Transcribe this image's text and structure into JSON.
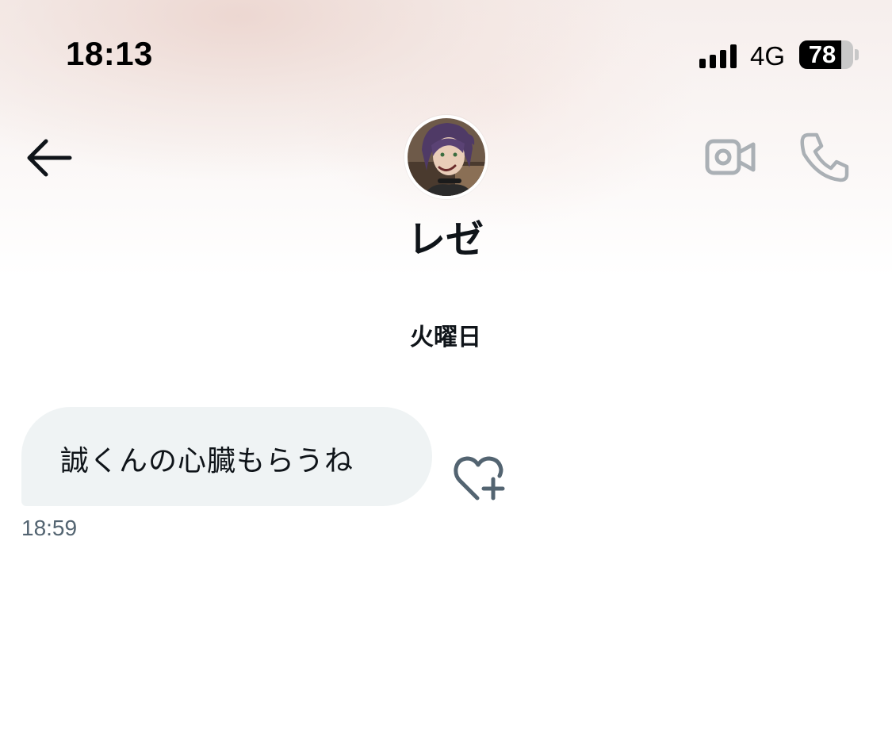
{
  "status_bar": {
    "time": "18:13",
    "network": "4G",
    "battery_level": "78",
    "battery_fraction": 0.78
  },
  "header": {
    "contact_name": "レゼ",
    "back_icon": "arrow-left-icon",
    "video_icon": "video-camera-icon",
    "call_icon": "phone-icon",
    "icon_color_active": "#0f1419",
    "icon_color_muted": "#aab0b5"
  },
  "conversation": {
    "day_label": "火曜日",
    "messages": [
      {
        "text": "誠くんの心臓もらうね",
        "time": "18:59",
        "reaction_icon": "heart-plus-icon"
      }
    ],
    "bubble_color": "#eff3f4",
    "time_color": "#536471"
  }
}
